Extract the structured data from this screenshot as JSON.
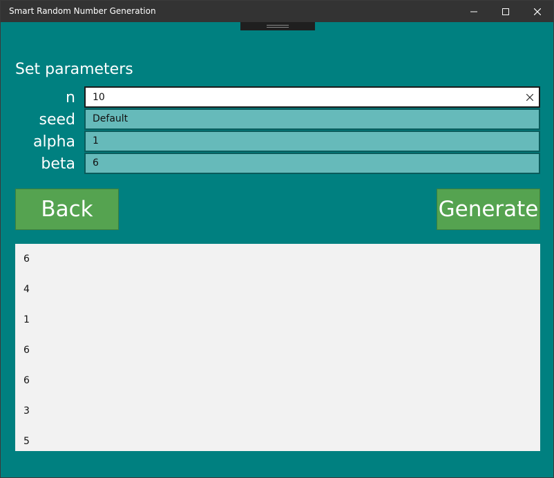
{
  "window": {
    "title": "Smart Random Number Generation"
  },
  "page": {
    "section_title": "Set parameters"
  },
  "params": {
    "n": {
      "label": "n",
      "value": "10"
    },
    "seed": {
      "label": "seed",
      "value": "Default"
    },
    "alpha": {
      "label": "alpha",
      "value": "1"
    },
    "beta": {
      "label": "beta",
      "value": "6"
    }
  },
  "actions": {
    "back_label": "Back",
    "generate_label": "Generate"
  },
  "results": [
    "6",
    "4",
    "1",
    "6",
    "6",
    "3",
    "5"
  ],
  "colors": {
    "background": "#008080",
    "field": "#66baba",
    "button": "#55a350",
    "titlebar": "#333333",
    "results_panel": "#f2f2f2"
  }
}
